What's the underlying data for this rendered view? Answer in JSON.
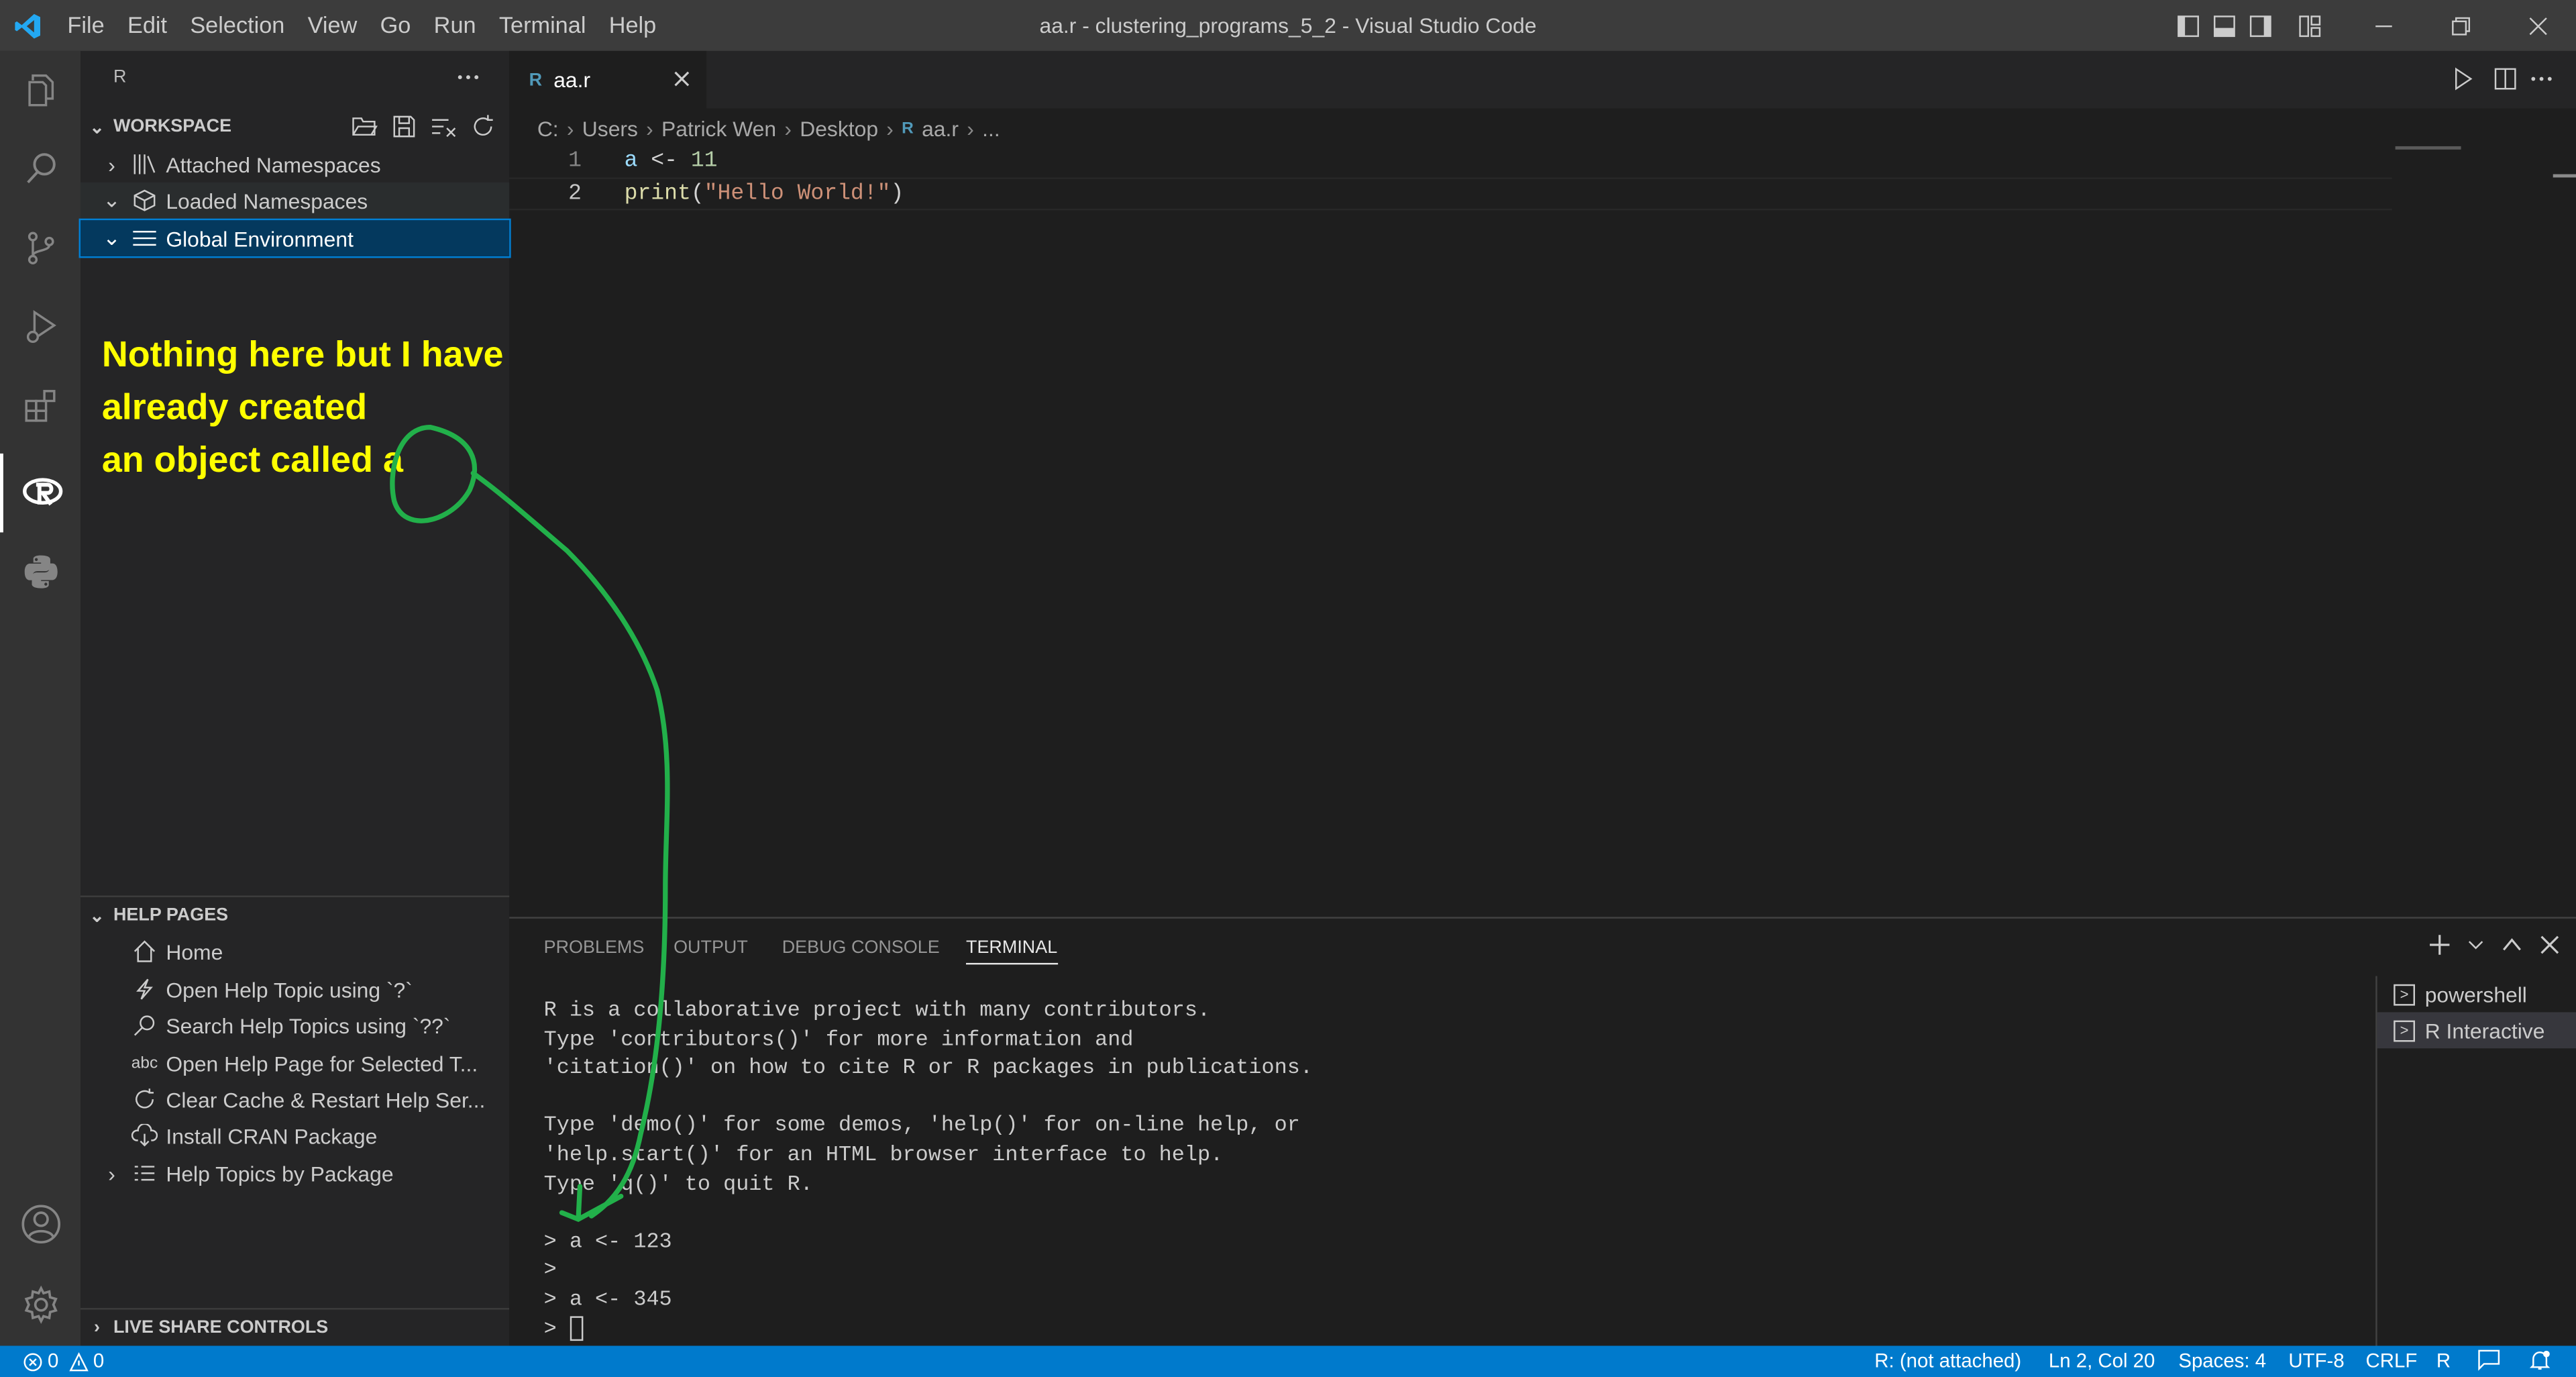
{
  "window": {
    "title": "aa.r - clustering_programs_5_2 - Visual Studio Code"
  },
  "menu": [
    "File",
    "Edit",
    "Selection",
    "View",
    "Go",
    "Run",
    "Terminal",
    "Help"
  ],
  "sidebar": {
    "title": "R",
    "workspace": {
      "header": "WORKSPACE",
      "items": [
        "Attached Namespaces",
        "Loaded Namespaces",
        "Global Environment"
      ]
    },
    "help": {
      "header": "HELP PAGES",
      "items": [
        "Home",
        "Open Help Topic using `?`",
        "Search Help Topics using `??`",
        "Open Help Page for Selected T...",
        "Clear Cache & Restart Help Ser...",
        "Install CRAN Package",
        "Help Topics by Package"
      ]
    },
    "liveshare": "LIVE SHARE CONTROLS"
  },
  "editor": {
    "tab": "aa.r",
    "breadcrumb": [
      "C:",
      "Users",
      "Patrick Wen",
      "Desktop",
      "aa.r",
      "..."
    ],
    "lines": [
      {
        "num": "1",
        "parts": [
          [
            "a",
            "#9cdcfe"
          ],
          [
            " <- ",
            "#d4d4d4"
          ],
          [
            "11",
            "#b5cea8"
          ]
        ]
      },
      {
        "num": "2",
        "parts": [
          [
            "print",
            "#dcdcaa"
          ],
          [
            "(",
            "#d4d4d4"
          ],
          [
            "\"Hello World!\"",
            "#ce9178"
          ],
          [
            ")",
            "#d4d4d4"
          ]
        ]
      }
    ]
  },
  "panel": {
    "tabs": [
      "PROBLEMS",
      "OUTPUT",
      "DEBUG CONSOLE",
      "TERMINAL"
    ],
    "terminal_lines": [
      "R is a collaborative project with many contributors.",
      "Type 'contributors()' for more information and",
      "'citation()' on how to cite R or R packages in publications.",
      "",
      "Type 'demo()' for some demos, 'help()' for on-line help, or",
      "'help.start()' for an HTML browser interface to help.",
      "Type 'q()' to quit R.",
      "",
      "> a <- 123",
      ">",
      "> a <- 345",
      "> "
    ],
    "terminals": [
      "powershell",
      "R Interactive"
    ]
  },
  "annotation": "Nothing here but I have\nalready created\nan object called a",
  "status": {
    "errors": "0",
    "warnings": "0",
    "r_session": "R: (not attached)",
    "position": "Ln 2, Col 20",
    "spaces": "Spaces: 4",
    "encoding": "UTF-8",
    "eol": "CRLF",
    "language": "R"
  },
  "colors": {
    "accent": "#007acc",
    "annotation_text": "#ffff00",
    "annotation_arrow": "#22b04a"
  }
}
